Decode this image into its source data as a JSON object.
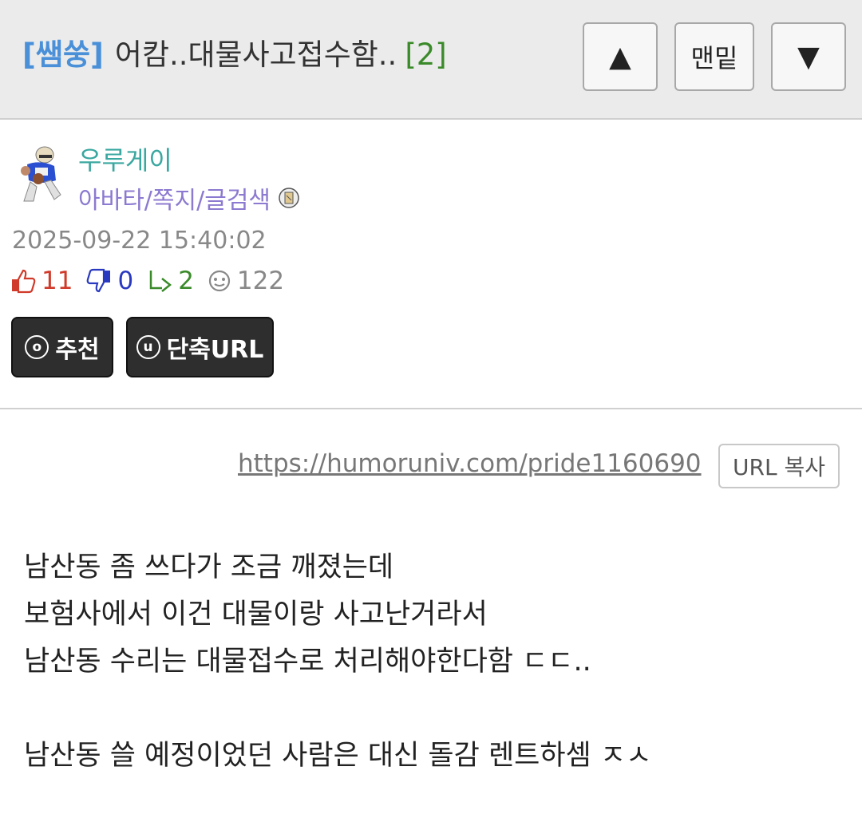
{
  "header": {
    "category": "[쌤쑹]",
    "title": "어캄..대물사고접수함..",
    "comment_count": "[2]",
    "nav": {
      "up_icon": "triangle-up-icon",
      "bottom_label": "맨밑",
      "down_icon": "triangle-down-icon"
    }
  },
  "author": {
    "name": "우루게이",
    "links": "아바타/쪽지/글검색",
    "avatar_icon": "football-player-avatar"
  },
  "post": {
    "date": "2025-09-22 15:40:02",
    "stats": {
      "upvotes": "11",
      "downvotes": "0",
      "replies": "2",
      "views": "122"
    },
    "buttons": {
      "recommend": "추천",
      "shorturl": "단축URL",
      "recommend_glyph": "o",
      "shorturl_glyph": "u"
    },
    "url": "https://humoruniv.com/pride1160690",
    "copy_label": "URL 복사",
    "body": [
      "남산동 좀 쓰다가 조금 깨졌는데",
      "보험사에서 이건 대물이랑 사고난거라서",
      "남산동 수리는 대물접수로 처리해야한다함 ㄷㄷ..",
      "",
      "남산동 쓸 예정이었던 사람은 대신 돌감 렌트하셈 ㅈㅅ"
    ]
  },
  "colors": {
    "category": "#4a90d9",
    "author": "#3aa7a0",
    "links": "#8c7ad0",
    "upvote": "#d03a2a",
    "downvote": "#2a3ac0",
    "reply": "#3a8a2a"
  }
}
